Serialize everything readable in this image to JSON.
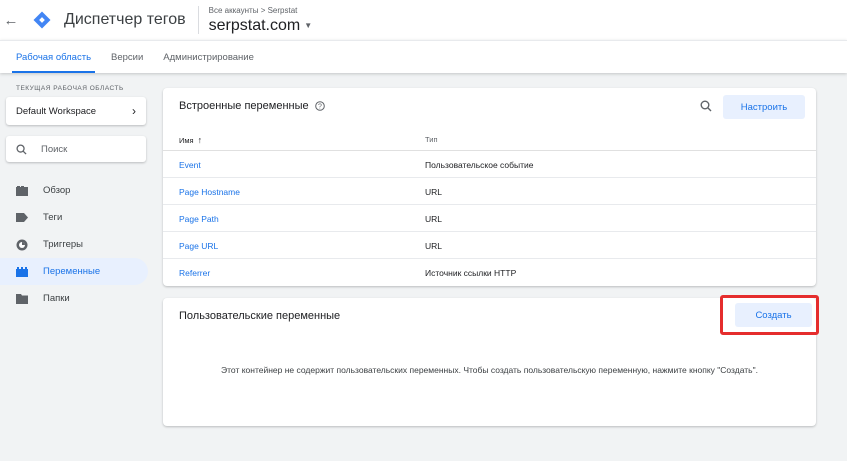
{
  "header": {
    "app_title": "Диспетчер тегов",
    "breadcrumb": "Все аккаунты > Serpstat",
    "container_name": "serpstat.com"
  },
  "tabs": [
    {
      "label": "Рабочая область",
      "active": true
    },
    {
      "label": "Версии",
      "active": false
    },
    {
      "label": "Администрирование",
      "active": false
    }
  ],
  "sidebar": {
    "workspace_label": "ТЕКУЩАЯ РАБОЧАЯ ОБЛАСТЬ",
    "workspace_name": "Default Workspace",
    "search_placeholder": "Поиск",
    "items": [
      {
        "label": "Обзор",
        "icon": "overview-icon",
        "active": false
      },
      {
        "label": "Теги",
        "icon": "tag-icon",
        "active": false
      },
      {
        "label": "Триггеры",
        "icon": "trigger-icon",
        "active": false
      },
      {
        "label": "Переменные",
        "icon": "variables-icon",
        "active": true
      },
      {
        "label": "Папки",
        "icon": "folder-icon",
        "active": false
      }
    ]
  },
  "builtin": {
    "title": "Встроенные переменные",
    "configure_label": "Настроить",
    "col_name": "Имя",
    "col_type": "Тип",
    "rows": [
      {
        "name": "Event",
        "type": "Пользовательское событие"
      },
      {
        "name": "Page Hostname",
        "type": "URL"
      },
      {
        "name": "Page Path",
        "type": "URL"
      },
      {
        "name": "Page URL",
        "type": "URL"
      },
      {
        "name": "Referrer",
        "type": "Источник ссылки HTTP"
      }
    ]
  },
  "custom": {
    "title": "Пользовательские переменные",
    "create_label": "Создать",
    "empty_message": "Этот контейнер не содержит пользовательских переменных. Чтобы создать пользовательскую переменную, нажмите кнопку \"Создать\"."
  },
  "colors": {
    "accent": "#1a73e8",
    "highlight": "#e52d2d",
    "logo": "#4285f4"
  }
}
